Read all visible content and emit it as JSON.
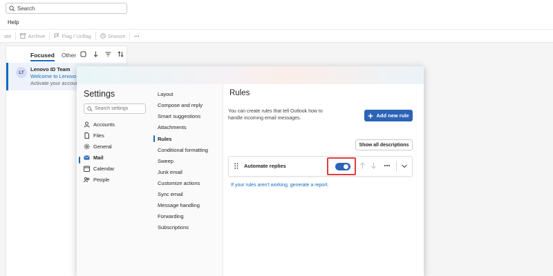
{
  "search": {
    "placeholder": "Search"
  },
  "menu": {
    "help": "Help"
  },
  "toolbar": {
    "items": [
      {
        "label": "ate",
        "icon": "unknown"
      },
      {
        "label": "Archive",
        "icon": "archive-icon"
      },
      {
        "label": "Flag / Unflag",
        "icon": "flag-icon"
      },
      {
        "label": "Snooze",
        "icon": "clock-icon"
      },
      {
        "label": "···",
        "icon": "more-icon"
      }
    ]
  },
  "message_list": {
    "tabs": {
      "focused": "Focused",
      "other": "Other"
    },
    "messages": [
      {
        "initials": "LT",
        "sender": "Lenovo ID Team",
        "subject": "Welcome to Lenovo",
        "preview": "Activate your account"
      }
    ]
  },
  "settings": {
    "title": "Settings",
    "search_placeholder": "Search settings",
    "categories": [
      {
        "label": "Accounts",
        "icon": "person-icon"
      },
      {
        "label": "Files",
        "icon": "file-icon"
      },
      {
        "label": "General",
        "icon": "gear-icon"
      },
      {
        "label": "Mail",
        "icon": "mail-icon",
        "selected": true
      },
      {
        "label": "Calendar",
        "icon": "calendar-icon"
      },
      {
        "label": "People",
        "icon": "people-icon"
      }
    ],
    "subcategories": [
      "Layout",
      "Compose and reply",
      "Smart suggestions",
      "Attachments",
      "Rules",
      "Conditional formatting",
      "Sweep",
      "Junk email",
      "Customize actions",
      "Sync email",
      "Message handling",
      "Forwarding",
      "Subscriptions"
    ],
    "selected_subcategory": "Rules"
  },
  "rules": {
    "title": "Rules",
    "description": "You can create rules that tell Outlook how to handle incoming email messages.",
    "add_button": "Add new rule",
    "show_all_button": "Show all descriptions",
    "items": [
      {
        "name": "Automate replies",
        "enabled": true
      }
    ],
    "report_link": "If your rules aren't working, generate a report."
  },
  "colors": {
    "accent": "#2c63b8",
    "link": "#0f6cbd",
    "highlight": "#e03c3c"
  }
}
